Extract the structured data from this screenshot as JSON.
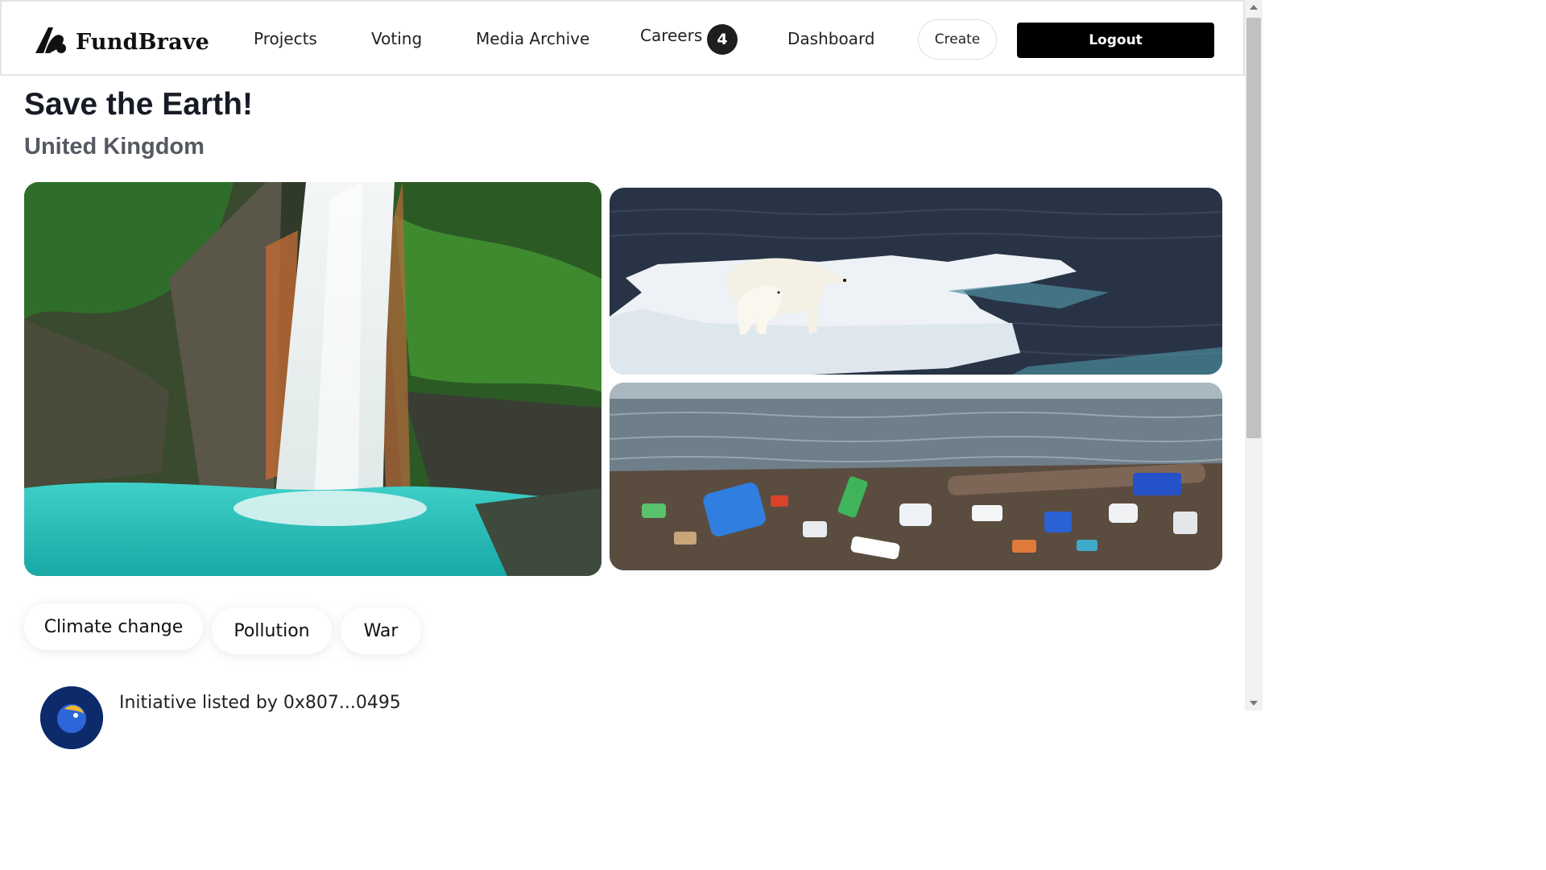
{
  "navbar": {
    "brand": "FundBrave",
    "links": [
      {
        "label": "Projects"
      },
      {
        "label": "Voting"
      },
      {
        "label": "Media Archive"
      },
      {
        "label": "Careers",
        "badge": "4"
      },
      {
        "label": "Dashboard"
      }
    ],
    "create_label": "Create",
    "logout_label": "Logout"
  },
  "project": {
    "title": "Save the Earth!",
    "location": "United Kingdom",
    "images": [
      {
        "name": "waterfall-image",
        "icon": "waterfall-photo"
      },
      {
        "name": "polar-bears-image",
        "icon": "polar-bears-on-ice-photo"
      },
      {
        "name": "beach-pollution-image",
        "icon": "plastic-waste-beach-photo"
      }
    ],
    "tags": [
      "Climate change",
      "Pollution",
      "War"
    ],
    "listed_by": "Initiative listed by 0x807...0495"
  },
  "colors": {
    "primary": "#000000",
    "badge": "#1e1e1e",
    "title": "#171b26",
    "subtitle": "#555961"
  }
}
